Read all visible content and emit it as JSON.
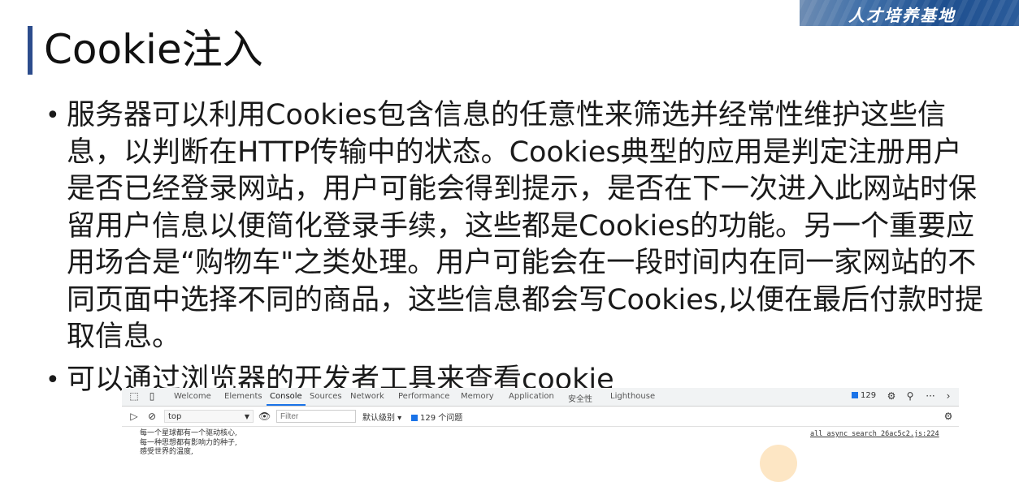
{
  "banner": {
    "text": "人才培养基地"
  },
  "slide": {
    "title": "Cookie注入",
    "bullets": [
      "服务器可以利用Cookies包含信息的任意性来筛选并经常性维护这些信息，以判断在HTTP传输中的状态。Cookies典型的应用是判定注册用户是否已经登录网站，用户可能会得到提示，是否在下一次进入此网站时保留用户信息以便简化登录手续，这些都是Cookies的功能。另一个重要应用场合是“购物车\"之类处理。用户可能会在一段时间内在同一家网站的不同页面中选择不同的商品，这些信息都会写Cookies,以便在最后付款时提取信息。",
      "可以通过浏览器的开发者工具来查看cookie"
    ]
  },
  "devtools": {
    "tabs": [
      "Welcome",
      "Elements",
      "Console",
      "Sources",
      "Network",
      "Performance",
      "Memory",
      "Application",
      "安全性",
      "Lighthouse"
    ],
    "active_tab": "Console",
    "issues_count": "129",
    "more_glyph": "···",
    "more_tabs_glyph": "›",
    "context": "top",
    "filter_placeholder": "Filter",
    "levels_label": "默认级别 ▾",
    "issues_label": "129 个问题",
    "console_lines": [
      "每一个星球都有一个驱动核心,",
      "每一种思想都有影响力的种子,",
      "感受世界的温度,"
    ],
    "source_link": "all_async_search_26ac5c2.js:224"
  }
}
